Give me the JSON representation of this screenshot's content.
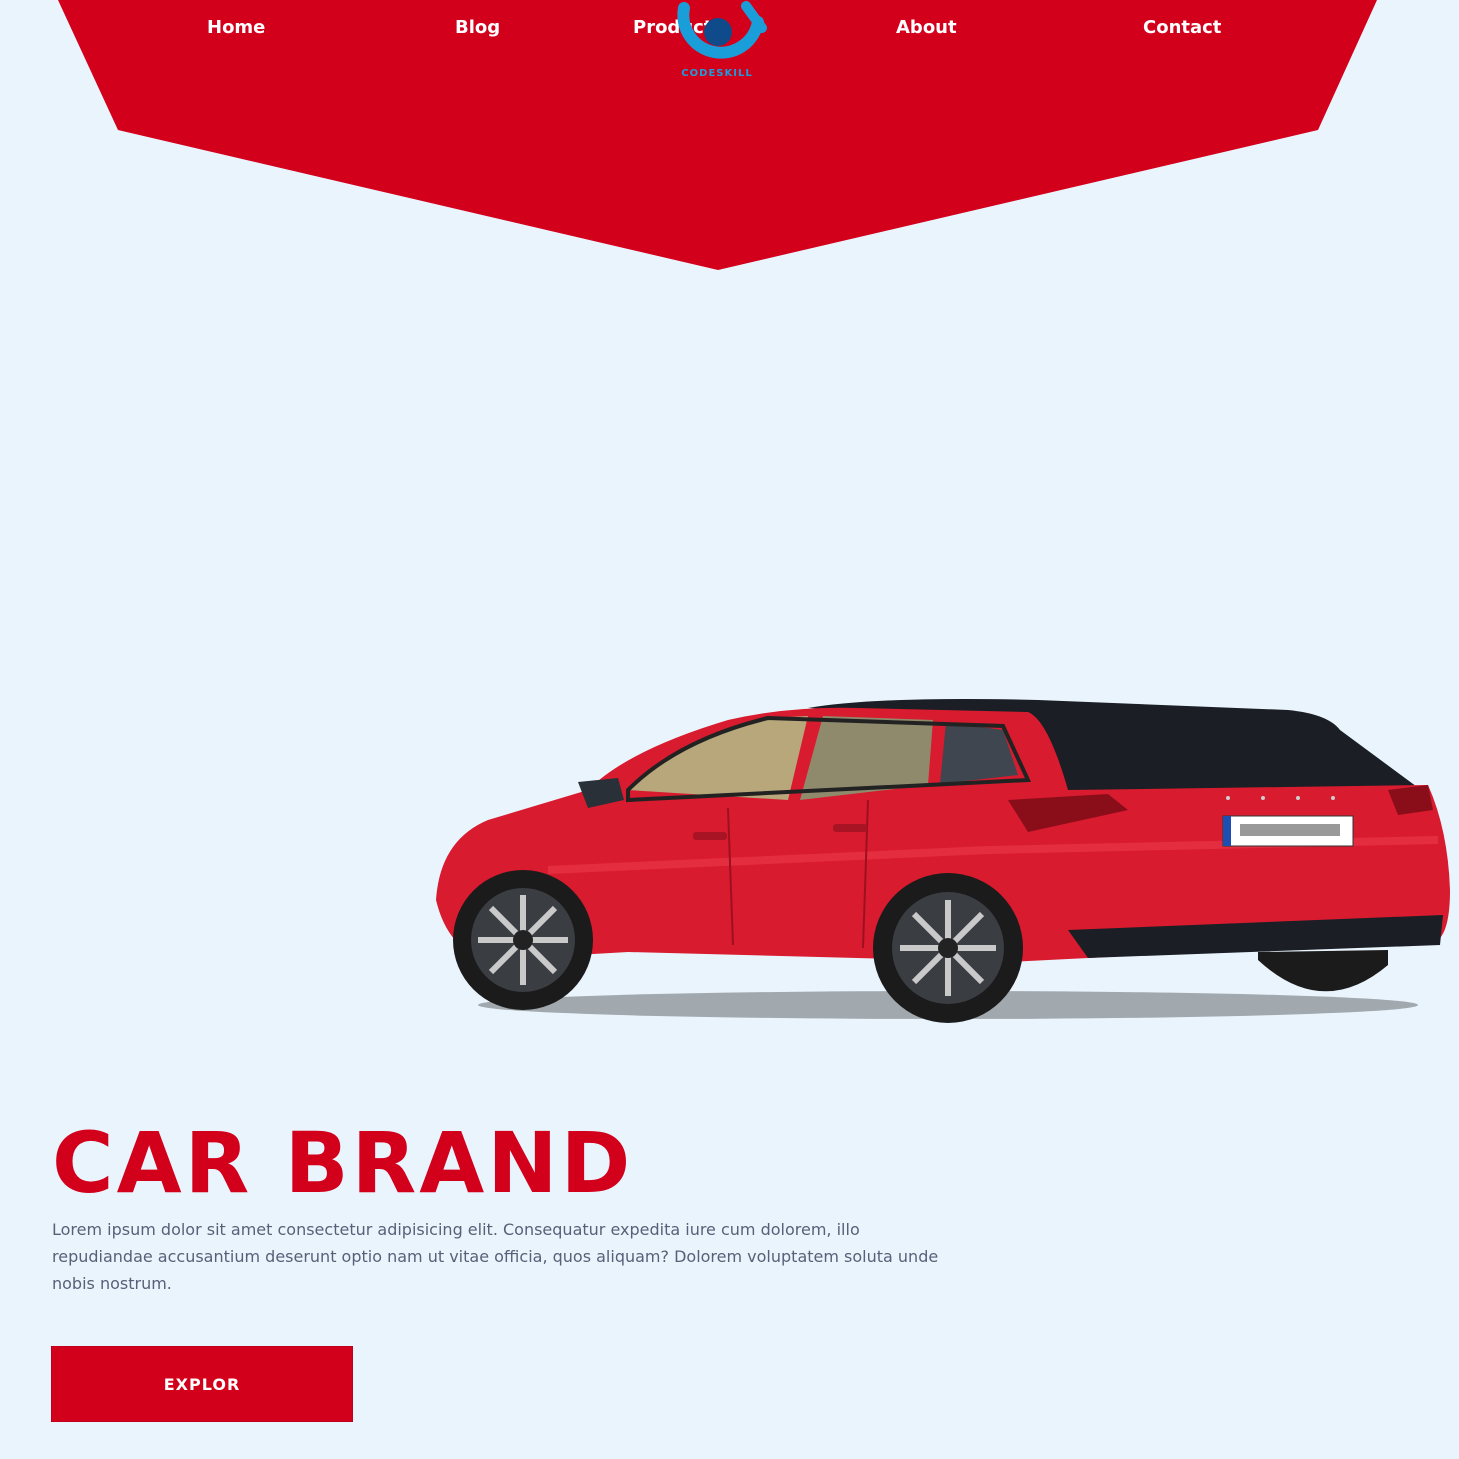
{
  "nav": {
    "items": [
      {
        "label": "Home"
      },
      {
        "label": "Blog"
      },
      {
        "label": "Product"
      },
      {
        "label": "About"
      },
      {
        "label": "Contact"
      }
    ]
  },
  "logo": {
    "text": "CODESKILL",
    "colors": {
      "outer": "#1a9ed9",
      "inner": "#0f4a8a"
    }
  },
  "hero": {
    "headline": "CAR BRAND",
    "description": "Lorem ipsum dolor sit amet consectetur adipisicing elit. Consequatur expedita iure cum dolorem, illo repudiandae accusantium deserunt optio nam ut vitae officia, quos aliquam? Dolorem voluptatem soluta unde nobis nostrum.",
    "cta_label": "EXPLOR",
    "image_alt": "red hatchback car"
  },
  "colors": {
    "brand": "#d3001c",
    "background": "#eaf4fd",
    "text": "#5a5f78"
  }
}
